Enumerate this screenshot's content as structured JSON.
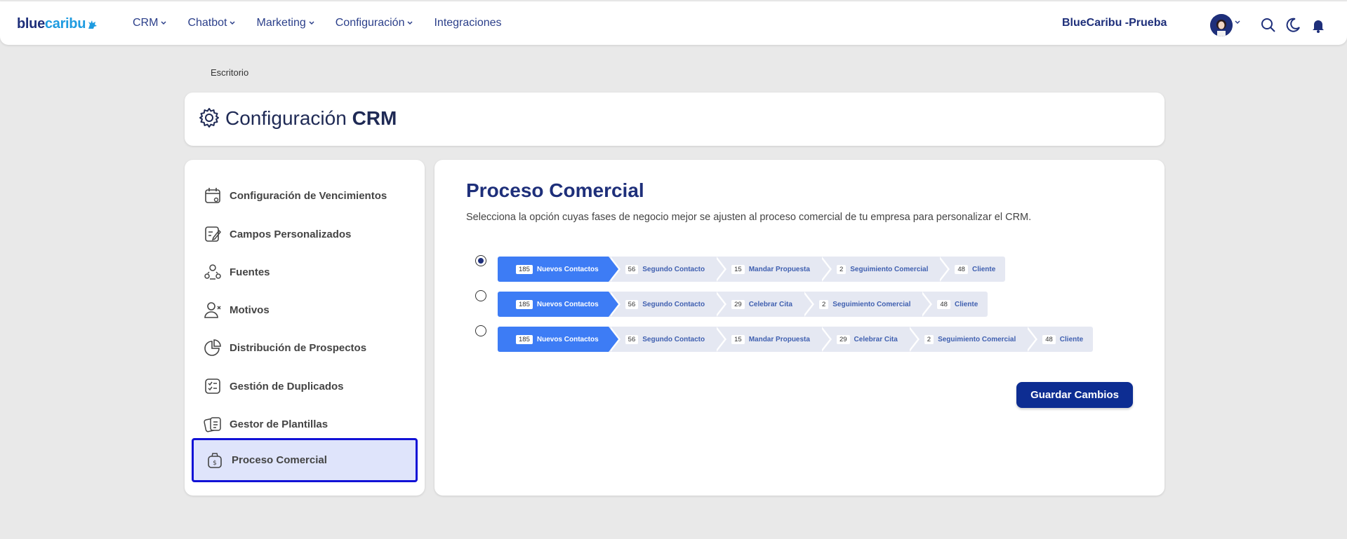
{
  "brand": {
    "part1": "blue",
    "part2": "caribu"
  },
  "nav": [
    "CRM",
    "Chatbot",
    "Marketing",
    "Configuración",
    "Integraciones"
  ],
  "account_name": "BlueCaribu -Prueba",
  "breadcrumb": "Escritorio",
  "header": {
    "title_plain": "Configuración ",
    "title_bold": "CRM"
  },
  "sidebar": {
    "items": [
      {
        "label": "Configuración de Vencimientos",
        "icon": "calendar-clock-icon"
      },
      {
        "label": "Campos Personalizados",
        "icon": "edit-form-icon"
      },
      {
        "label": "Fuentes",
        "icon": "users-network-icon"
      },
      {
        "label": "Motivos",
        "icon": "user-x-icon"
      },
      {
        "label": "Distribución de Prospectos",
        "icon": "pie-chart-icon"
      },
      {
        "label": "Gestión de Duplicados",
        "icon": "checklist-icon"
      },
      {
        "label": "Gestor de Plantillas",
        "icon": "templates-icon"
      },
      {
        "label": "Proceso Comercial",
        "icon": "money-bag-icon",
        "active": true
      }
    ]
  },
  "main": {
    "title": "Proceso Comercial",
    "description": "Selecciona la opción cuyas fases de negocio mejor se ajusten al proceso comercial de tu empresa para personalizar el CRM.",
    "options": [
      {
        "selected": true,
        "stages": [
          {
            "count": "185",
            "label": "Nuevos Contactos"
          },
          {
            "count": "56",
            "label": "Segundo Contacto"
          },
          {
            "count": "15",
            "label": "Mandar Propuesta"
          },
          {
            "count": "2",
            "label": "Seguimiento Comercial"
          },
          {
            "count": "48",
            "label": "Cliente"
          }
        ]
      },
      {
        "selected": false,
        "stages": [
          {
            "count": "185",
            "label": "Nuevos Contactos"
          },
          {
            "count": "56",
            "label": "Segundo Contacto"
          },
          {
            "count": "29",
            "label": "Celebrar Cita"
          },
          {
            "count": "2",
            "label": "Seguimiento Comercial"
          },
          {
            "count": "48",
            "label": "Cliente"
          }
        ]
      },
      {
        "selected": false,
        "stages": [
          {
            "count": "185",
            "label": "Nuevos Contactos"
          },
          {
            "count": "56",
            "label": "Segundo Contacto"
          },
          {
            "count": "15",
            "label": "Mandar Propuesta"
          },
          {
            "count": "29",
            "label": "Celebrar Cita"
          },
          {
            "count": "2",
            "label": "Seguimiento Comercial"
          },
          {
            "count": "48",
            "label": "Cliente"
          }
        ]
      }
    ],
    "save_label": "Guardar Cambios"
  },
  "colors": {
    "primary": "#0d2d92",
    "accent": "#3d7cf5",
    "active_border": "#1212d6"
  }
}
